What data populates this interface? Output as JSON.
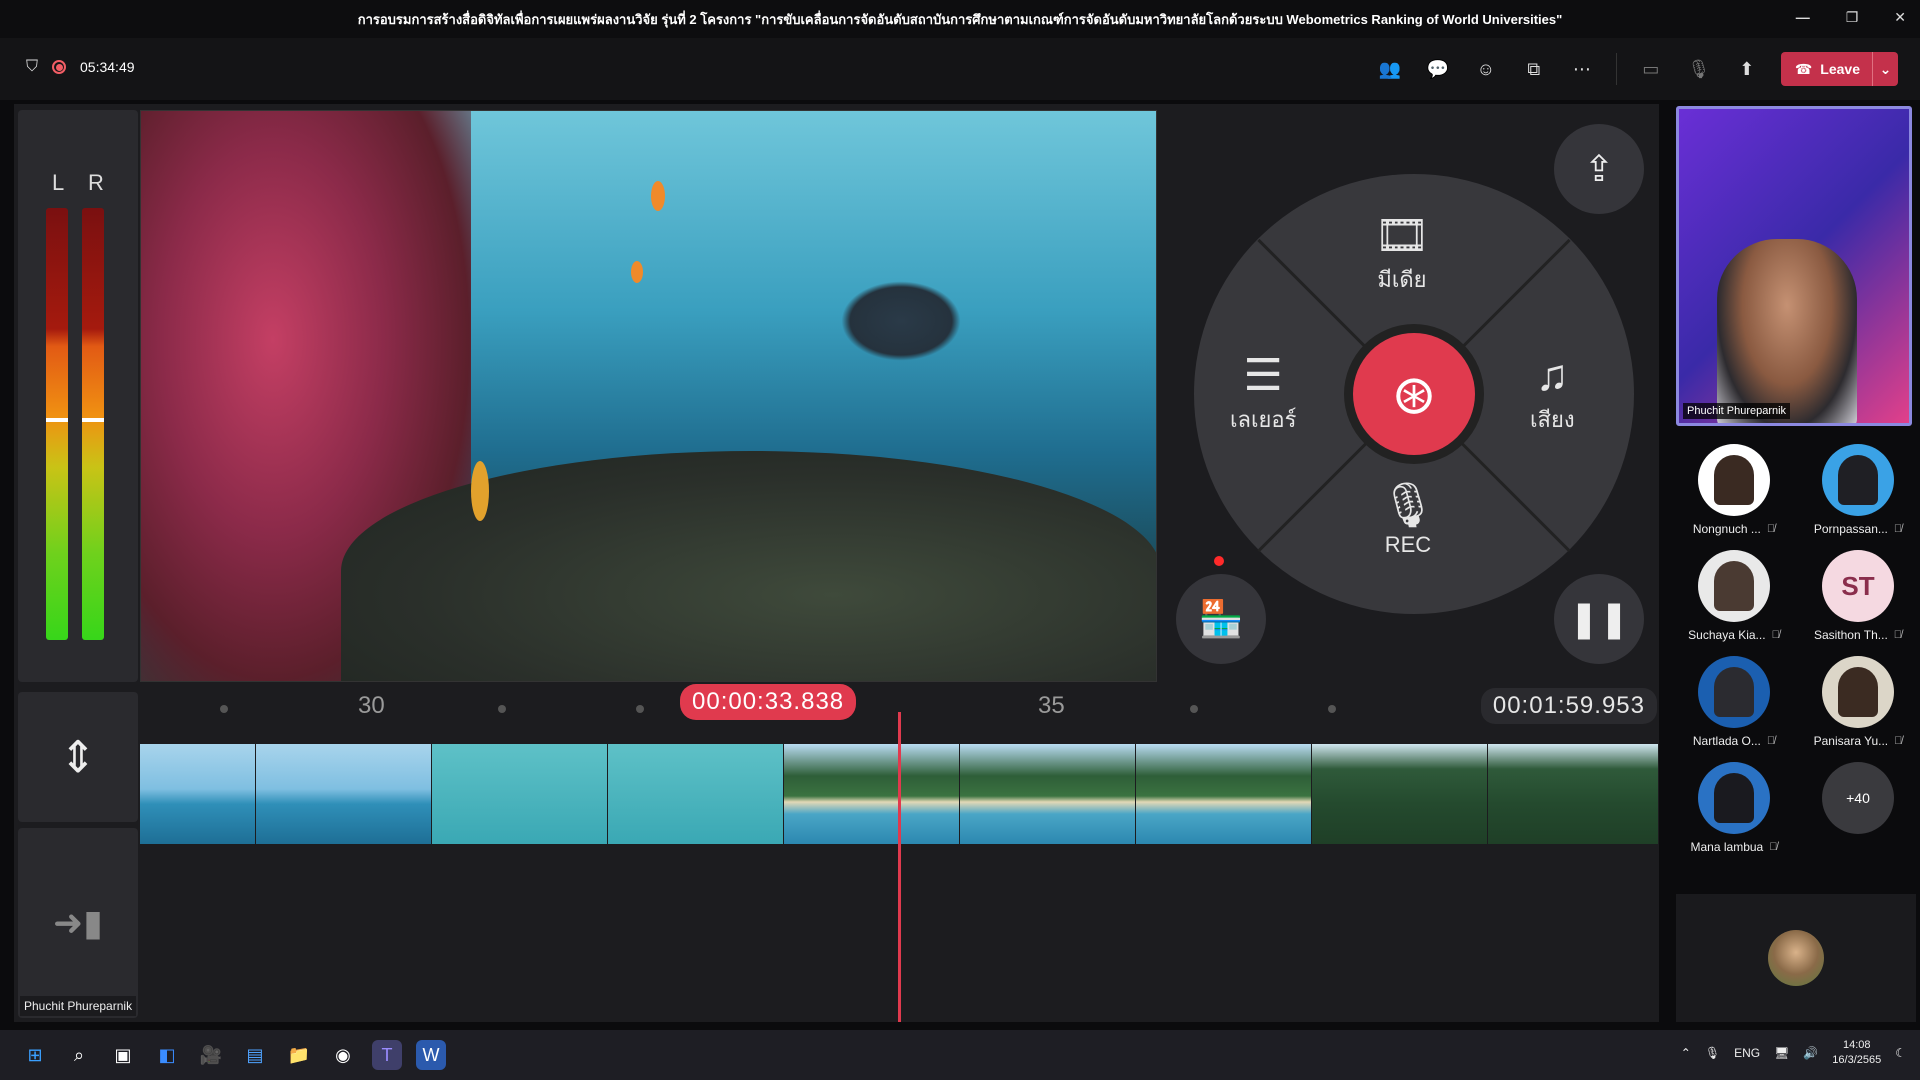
{
  "window": {
    "title": "การอบรมการสร้างสื่อดิจิทัลเพื่อการเผยแพร่ผลงานวิจัย รุ่นที่ 2 โครงการ \"การขับเคลื่อนการจัดอันดับสถาบันการศึกษาตามเกณฑ์การจัดอันดับมหาวิทยาลัยโลกด้วยระบบ Webometrics Ranking of World Universities\""
  },
  "meeting": {
    "elapsed": "05:34:49",
    "leave_label": "Leave"
  },
  "editor": {
    "meter_left": "L",
    "meter_right": "R",
    "wheel": {
      "media": "มีเดีย",
      "layer": "เลเยอร์",
      "audio": "เสียง",
      "rec": "REC"
    },
    "timeline": {
      "tick_30": "30",
      "tick_35": "35",
      "playhead_time": "00:00:33.838",
      "total_time": "00:01:59.953"
    },
    "presenter_tag": "Phuchit Phureparnik"
  },
  "speaker": {
    "name": "Phuchit Phureparnik"
  },
  "participants": [
    {
      "name": "Nongnuch ...",
      "initials": "",
      "color": "#ffffff"
    },
    {
      "name": "Pornpassan...",
      "initials": "",
      "color": "#3aa2e6"
    },
    {
      "name": "Suchaya Kia...",
      "initials": "",
      "color": "#e9e9e9"
    },
    {
      "name": "Sasithon Th...",
      "initials": "ST",
      "color": "#f5d9e1"
    },
    {
      "name": "Nartlada O...",
      "initials": "",
      "color": "#1b5fb0"
    },
    {
      "name": "Panisara Yu...",
      "initials": "",
      "color": "#dcd6c8"
    },
    {
      "name": "Mana lambua",
      "initials": "",
      "color": "#2a72c4"
    },
    {
      "name": "",
      "initials": "+40",
      "color": "#3a3a3e"
    }
  ],
  "system": {
    "lang": "ENG",
    "time": "14:08",
    "date": "16/3/2565"
  },
  "colors": {
    "accent_red": "#e03a4e",
    "teams_leave": "#c4314b"
  }
}
